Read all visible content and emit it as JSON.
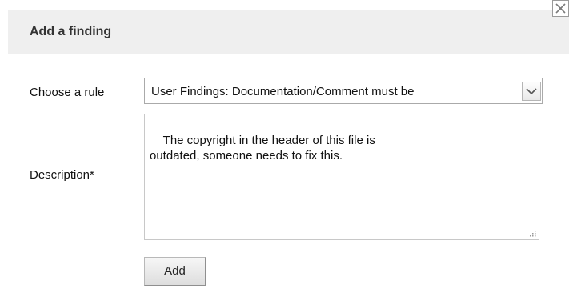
{
  "dialog": {
    "title": "Add a finding",
    "close_icon": "close-icon"
  },
  "form": {
    "rule_label": "Choose a rule",
    "rule_selected": "User Findings: Documentation/Comment must be",
    "description_label": "Description*",
    "description_value": "The copyright in the header of this file is\noutdated, someone needs to fix this.",
    "add_button_label": "Add"
  },
  "colors": {
    "header_background": "#efefef",
    "button_background": "#e6e6e6"
  }
}
